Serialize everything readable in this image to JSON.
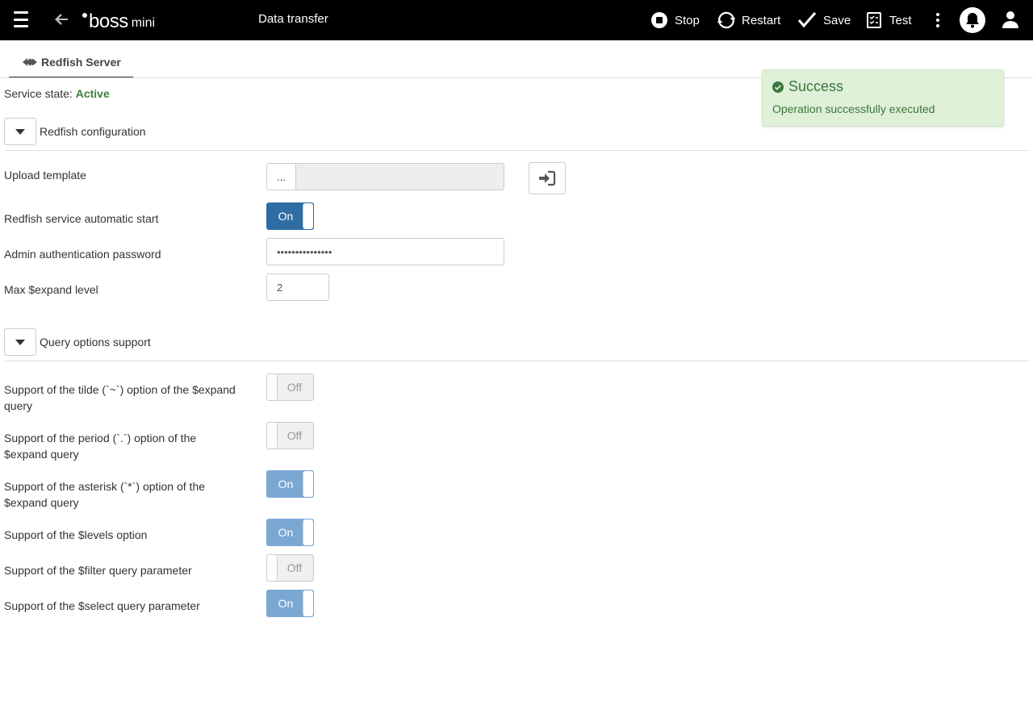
{
  "header": {
    "logo_boss": "boss",
    "logo_mini": "mini",
    "title": "Data transfer",
    "actions": {
      "stop": "Stop",
      "restart": "Restart",
      "save": "Save",
      "test": "Test"
    }
  },
  "tab": {
    "label": "Redfish Server"
  },
  "service_state": {
    "label": "Service state:",
    "value": "Active"
  },
  "sections": {
    "config": {
      "title": "Redfish configuration"
    },
    "query": {
      "title": "Query options support"
    }
  },
  "config": {
    "upload_template": {
      "label": "Upload template",
      "browse_label": "..."
    },
    "auto_start": {
      "label": "Redfish service automatic start",
      "state": "On"
    },
    "admin_password": {
      "label": "Admin authentication password",
      "value": "•••••••••••••••"
    },
    "max_expand": {
      "label": "Max $expand level",
      "value": "2"
    }
  },
  "query_options": [
    {
      "label": "Support of the tilde (`~`) option of the $expand query",
      "state": "Off"
    },
    {
      "label": "Support of the period (`.`) option of the $expand query",
      "state": "Off"
    },
    {
      "label": "Support of the asterisk (`*`) option of the $expand query",
      "state": "On"
    },
    {
      "label": "Support of the $levels option",
      "state": "On"
    },
    {
      "label": "Support of the $filter query parameter",
      "state": "Off"
    },
    {
      "label": "Support of the $select query parameter",
      "state": "On"
    }
  ],
  "toast": {
    "title": "Success",
    "message": "Operation successfully executed"
  },
  "colors": {
    "topbar": "#000000",
    "toggle_on": "#2e6da4",
    "toggle_on_disabled": "#7ba7d3",
    "active_state": "#3c7d3c",
    "toast_bg": "#dff0d8",
    "toast_text": "#3c763d"
  }
}
